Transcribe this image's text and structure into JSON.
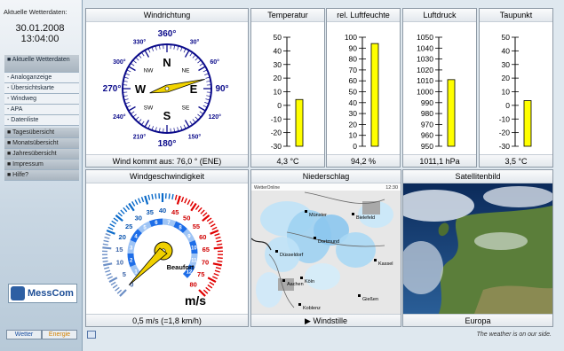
{
  "sidebar": {
    "current_label": "Aktuelle Wetterdaten:",
    "date": "30.01.2008",
    "time": "13:04:00",
    "menu": [
      {
        "label": "■ Aktuelle Wetterdaten",
        "kind": "active"
      },
      {
        "label": "- Analoganzeige",
        "kind": "sub"
      },
      {
        "label": "- Übersichtskarte",
        "kind": "sub"
      },
      {
        "label": "- Windweg",
        "kind": "sub"
      },
      {
        "label": "- APA",
        "kind": "sub"
      },
      {
        "label": "- Datenliste",
        "kind": "sub"
      },
      {
        "label": "■ Tagesübersicht",
        "kind": "grp"
      },
      {
        "label": "■ Monatsübersicht",
        "kind": "grp"
      },
      {
        "label": "■ Jahresübersicht",
        "kind": "grp"
      },
      {
        "label": "■ Impressum",
        "kind": "grp"
      },
      {
        "label": "■ Hilfe?",
        "kind": "grp"
      }
    ],
    "logo_text": "MessCom",
    "btn_wetter": "Wetter",
    "btn_energie": "Energie"
  },
  "panels": {
    "windrichtung": {
      "title": "Windrichtung",
      "footer": "Wind kommt aus: 76,0 ° (ENE)"
    },
    "temperatur": {
      "title": "Temperatur",
      "footer": "4,3 °C"
    },
    "luftfeuchte": {
      "title": "rel. Luftfeuchte",
      "footer": "94,2 %"
    },
    "luftdruck": {
      "title": "Luftdruck",
      "footer": "1011,1 hPa"
    },
    "taupunkt": {
      "title": "Taupunkt",
      "footer": "3,5 °C"
    },
    "windgeschwindigkeit": {
      "title": "Windgeschwindigkeit",
      "footer": "0,5 m/s (=1,8 km/h)"
    },
    "niederschlag": {
      "title": "Niederschlag",
      "footer": "▶ Windstille"
    },
    "satellitenbild": {
      "title": "Satellitenbild",
      "footer": "Europa"
    }
  },
  "compass": {
    "direction_deg": 76.0,
    "degree_labels": [
      "360°",
      "30°",
      "60°",
      "90°",
      "120°",
      "150°",
      "180°",
      "210°",
      "240°",
      "270°",
      "300°",
      "330°"
    ],
    "main_labels": [
      "N",
      "E",
      "S",
      "W"
    ],
    "inter_labels": [
      "NE",
      "SE",
      "SW",
      "NW"
    ]
  },
  "bars": {
    "temperatur": {
      "ticks": [
        "50",
        "40",
        "30",
        "20",
        "10",
        "0",
        "-10",
        "-20",
        "-30"
      ],
      "min": -30,
      "max": 50,
      "value": 4.3,
      "color": "#ffff00"
    },
    "luftfeuchte": {
      "ticks": [
        "100",
        "90",
        "80",
        "70",
        "60",
        "50",
        "40",
        "30",
        "20",
        "10",
        "0"
      ],
      "min": 0,
      "max": 100,
      "value": 94.2,
      "color": "#ffff00"
    },
    "luftdruck": {
      "ticks": [
        "1050",
        "1040",
        "1030",
        "1020",
        "1010",
        "1000",
        "990",
        "980",
        "970",
        "960",
        "950"
      ],
      "min": 950,
      "max": 1050,
      "value": 1011.1,
      "color": "#ffff00"
    },
    "taupunkt": {
      "ticks": [
        "50",
        "40",
        "30",
        "20",
        "10",
        "0",
        "-10",
        "-20",
        "-30"
      ],
      "min": -30,
      "max": 50,
      "value": 3.5,
      "color": "#ffff00"
    }
  },
  "speedo": {
    "value_ms": 0.5,
    "unit": "m/s",
    "beaufort_label": "Beaufort",
    "outer_ticks": [
      "0",
      "5",
      "10",
      "15",
      "20",
      "25",
      "30",
      "35",
      "40",
      "45",
      "50",
      "55",
      "60",
      "65",
      "70",
      "75",
      "80"
    ],
    "inner_ticks": [
      "1",
      "2",
      "3",
      "4",
      "5",
      "6",
      "7",
      "8",
      "9",
      "10",
      "11",
      "12"
    ]
  },
  "radar": {
    "brand": "WetterOnline",
    "time": "12:30",
    "cities": [
      "Münster",
      "Bielefeld",
      "Dortmund",
      "Düsseldorf",
      "Kassel",
      "Aachen",
      "Köln",
      "Gießen",
      "Koblenz"
    ]
  }
}
